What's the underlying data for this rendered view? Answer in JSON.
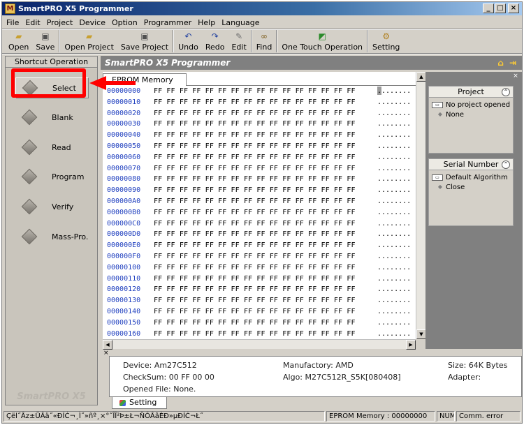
{
  "window": {
    "title": "SmartPRO X5 Programmer",
    "icon_letter": "M"
  },
  "menu": [
    "File",
    "Edit",
    "Project",
    "Device",
    "Option",
    "Programmer",
    "Help",
    "Language"
  ],
  "toolbar": [
    {
      "label": "Open",
      "icon": "folder-open-icon"
    },
    {
      "label": "Save",
      "icon": "floppy-icon"
    },
    {
      "label": "Open Project",
      "icon": "folder-open-icon"
    },
    {
      "label": "Save Project",
      "icon": "floppy-icon"
    },
    {
      "label": "Undo",
      "icon": "undo-icon"
    },
    {
      "label": "Redo",
      "icon": "redo-icon"
    },
    {
      "label": "Edit",
      "icon": "edit-icon"
    },
    {
      "label": "Find",
      "icon": "binoculars-icon"
    },
    {
      "label": "One Touch Operation",
      "icon": "one-touch-icon"
    },
    {
      "label": "Setting",
      "icon": "setting-icon"
    }
  ],
  "shortcut": {
    "header": "Shortcut Operation",
    "items": [
      "Select",
      "Blank",
      "Read",
      "Program",
      "Verify",
      "Mass-Pro."
    ],
    "brand": "SmartPRO X5"
  },
  "main": {
    "header": "SmartPRO X5 Programmer",
    "tab": "EPROM Memory",
    "rows": [
      {
        "addr": "00000000",
        "bytes": "FF FF FF FF FF FF FF FF FF FF FF FF FF FF FF FF",
        "ascii": "........"
      },
      {
        "addr": "00000010",
        "bytes": "FF FF FF FF FF FF FF FF FF FF FF FF FF FF FF FF",
        "ascii": "........"
      },
      {
        "addr": "00000020",
        "bytes": "FF FF FF FF FF FF FF FF FF FF FF FF FF FF FF FF",
        "ascii": "........"
      },
      {
        "addr": "00000030",
        "bytes": "FF FF FF FF FF FF FF FF FF FF FF FF FF FF FF FF",
        "ascii": "........"
      },
      {
        "addr": "00000040",
        "bytes": "FF FF FF FF FF FF FF FF FF FF FF FF FF FF FF FF",
        "ascii": "........"
      },
      {
        "addr": "00000050",
        "bytes": "FF FF FF FF FF FF FF FF FF FF FF FF FF FF FF FF",
        "ascii": "........"
      },
      {
        "addr": "00000060",
        "bytes": "FF FF FF FF FF FF FF FF FF FF FF FF FF FF FF FF",
        "ascii": "........"
      },
      {
        "addr": "00000070",
        "bytes": "FF FF FF FF FF FF FF FF FF FF FF FF FF FF FF FF",
        "ascii": "........"
      },
      {
        "addr": "00000080",
        "bytes": "FF FF FF FF FF FF FF FF FF FF FF FF FF FF FF FF",
        "ascii": "........"
      },
      {
        "addr": "00000090",
        "bytes": "FF FF FF FF FF FF FF FF FF FF FF FF FF FF FF FF",
        "ascii": "........"
      },
      {
        "addr": "000000A0",
        "bytes": "FF FF FF FF FF FF FF FF FF FF FF FF FF FF FF FF",
        "ascii": "........"
      },
      {
        "addr": "000000B0",
        "bytes": "FF FF FF FF FF FF FF FF FF FF FF FF FF FF FF FF",
        "ascii": "........"
      },
      {
        "addr": "000000C0",
        "bytes": "FF FF FF FF FF FF FF FF FF FF FF FF FF FF FF FF",
        "ascii": "........"
      },
      {
        "addr": "000000D0",
        "bytes": "FF FF FF FF FF FF FF FF FF FF FF FF FF FF FF FF",
        "ascii": "........"
      },
      {
        "addr": "000000E0",
        "bytes": "FF FF FF FF FF FF FF FF FF FF FF FF FF FF FF FF",
        "ascii": "........"
      },
      {
        "addr": "000000F0",
        "bytes": "FF FF FF FF FF FF FF FF FF FF FF FF FF FF FF FF",
        "ascii": "........"
      },
      {
        "addr": "00000100",
        "bytes": "FF FF FF FF FF FF FF FF FF FF FF FF FF FF FF FF",
        "ascii": "........"
      },
      {
        "addr": "00000110",
        "bytes": "FF FF FF FF FF FF FF FF FF FF FF FF FF FF FF FF",
        "ascii": "........"
      },
      {
        "addr": "00000120",
        "bytes": "FF FF FF FF FF FF FF FF FF FF FF FF FF FF FF FF",
        "ascii": "........"
      },
      {
        "addr": "00000130",
        "bytes": "FF FF FF FF FF FF FF FF FF FF FF FF FF FF FF FF",
        "ascii": "........"
      },
      {
        "addr": "00000140",
        "bytes": "FF FF FF FF FF FF FF FF FF FF FF FF FF FF FF FF",
        "ascii": "........"
      },
      {
        "addr": "00000150",
        "bytes": "FF FF FF FF FF FF FF FF FF FF FF FF FF FF FF FF",
        "ascii": "........"
      },
      {
        "addr": "00000160",
        "bytes": "FF FF FF FF FF FF FF FF FF FF FF FF FF FF FF FF",
        "ascii": "........"
      }
    ]
  },
  "project_panel": {
    "title": "Project",
    "item": "No project opened",
    "sub": "None"
  },
  "serial_panel": {
    "title": "Serial Number",
    "item": "Default Algorithm",
    "sub": "Close"
  },
  "info": {
    "device": "Device: Am27C512",
    "manufactory": "Manufactory: AMD",
    "size": "Size: 64K Bytes",
    "checksum": "CheckSum: 00 FF 00 00",
    "algo": "Algo: M27C512R_S5K[080408]",
    "adapter": "Adapter:",
    "opened_file": "Opened File: None."
  },
  "setting_tab": "Setting",
  "status": {
    "message": "Çël˝Âz±ÜÂä˝«ÐÍĆ¬¸Ì˝»ñº¸×°˝ÎÎ²Þ±Ł¬ÑÔÂâÈÐ»µÐÍĆ¬Ł˝",
    "memory": "EPROM Memory : 00000000",
    "num": "NUM",
    "comm": "Comm. error"
  },
  "colors": {
    "highlight": "#ff0000",
    "address": "#1f3fbf",
    "title_start": "#0a246a"
  }
}
